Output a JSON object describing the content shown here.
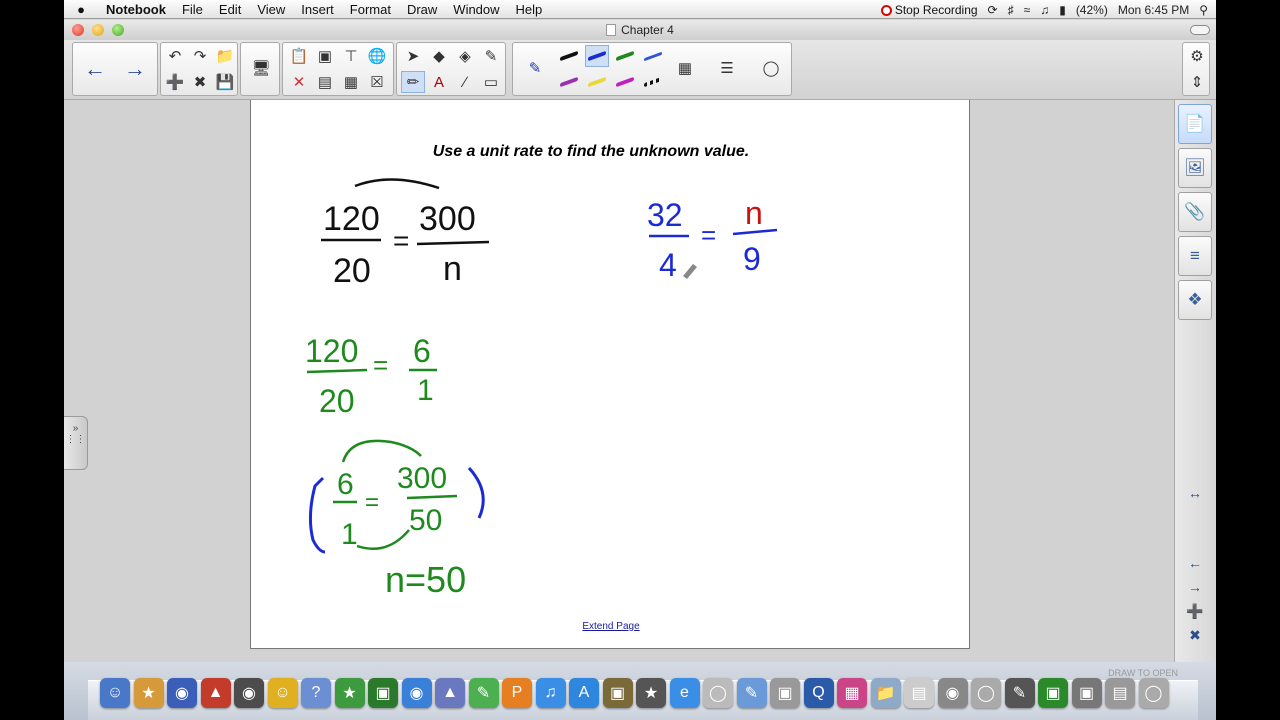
{
  "menubar": {
    "apple": "",
    "items": [
      "Notebook",
      "File",
      "Edit",
      "View",
      "Insert",
      "Format",
      "Draw",
      "Window",
      "Help"
    ],
    "recording": "Stop Recording",
    "battery": "(42%)",
    "clock": "Mon 6:45 PM"
  },
  "window": {
    "title": "Chapter 4"
  },
  "page": {
    "heading": "Use a unit rate to find the unknown value.",
    "extend_link": "Extend Page",
    "ink": {
      "p1_num_left": "120",
      "p1_den_left": "20",
      "p1_eq": "=",
      "p1_num_right": "300",
      "p1_den_right": "n",
      "p2_num_left": "32",
      "p2_den_left": "4",
      "p2_eq": "=",
      "p2_num_right": "n",
      "p2_den_right": "9",
      "s1_num_left": "120",
      "s1_den_left": "20",
      "s1_eq": "=",
      "s1_num_right": "6",
      "s1_den_right": "1",
      "s2_num_left": "6",
      "s2_den_left": "1",
      "s2_eq": "=",
      "s2_num_right": "300",
      "s2_den_right": "50",
      "answer": "n=50"
    }
  },
  "dock": {
    "overlay_text": "DRAW TO OPEN"
  },
  "colors": {
    "ink_black": "#111111",
    "ink_blue": "#1a2bd6",
    "ink_red": "#cc1111",
    "ink_green": "#1e8a1e",
    "toolbar_blue": "#2c4d8c"
  }
}
